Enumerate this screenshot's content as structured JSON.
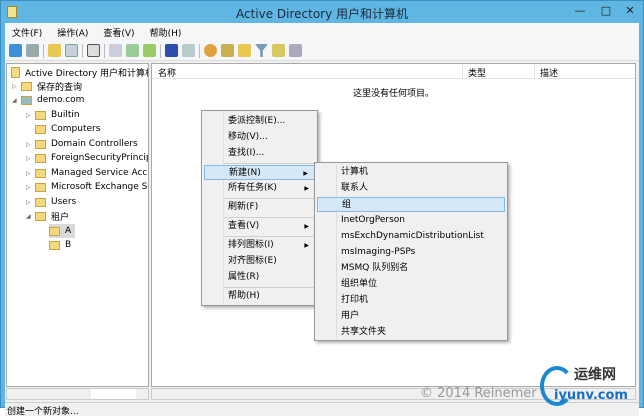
{
  "window": {
    "title": "Active Directory 用户和计算机"
  },
  "menubar": [
    "文件(F)",
    "操作(A)",
    "查看(V)",
    "帮助(H)"
  ],
  "tree": {
    "root": "Active Directory 用户和计算机",
    "items": [
      {
        "label": "保存的查询"
      },
      {
        "label": "demo.com"
      },
      {
        "label": "Builtin"
      },
      {
        "label": "Computers"
      },
      {
        "label": "Domain Controllers"
      },
      {
        "label": "ForeignSecurityPrincipals"
      },
      {
        "label": "Managed Service Accounts"
      },
      {
        "label": "Microsoft Exchange Security Groups"
      },
      {
        "label": "Users"
      },
      {
        "label": "租户"
      },
      {
        "label": "A"
      },
      {
        "label": "B"
      }
    ]
  },
  "list": {
    "columns": [
      "名称",
      "类型",
      "描述"
    ],
    "empty": "这里没有任何项目。"
  },
  "context_menu": [
    "委派控制(E)...",
    "移动(V)...",
    "查找(I)...",
    "新建(N)",
    "所有任务(K)",
    "刷新(F)",
    "查看(V)",
    "排列图标(I)",
    "对齐图标(E)",
    "属性(R)",
    "帮助(H)"
  ],
  "submenu": [
    "计算机",
    "联系人",
    "组",
    "InetOrgPerson",
    "msExchDynamicDistributionList",
    "msImaging-PSPs",
    "MSMQ 队列别名",
    "组织单位",
    "打印机",
    "用户",
    "共享文件夹"
  ],
  "status": "创建一个新对象...",
  "watermark": "© 2014 Reinemer",
  "logo": {
    "cn": "运维网",
    "en": "iyunv.com"
  },
  "colors": {
    "frame": "#5fb6e2",
    "highlight": "#d5e8f7"
  }
}
